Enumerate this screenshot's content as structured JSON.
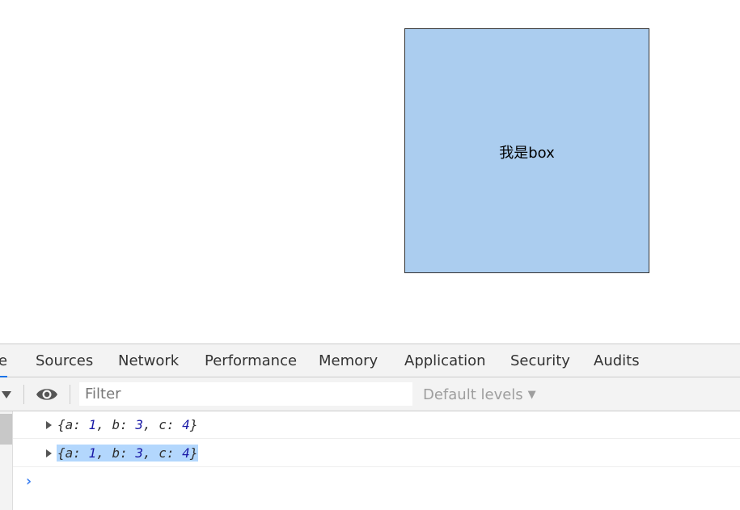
{
  "page": {
    "box_label": "我是box",
    "box_color": "#abcdef"
  },
  "devtools": {
    "tabs": [
      {
        "label": "e",
        "active": true
      },
      {
        "label": "Sources"
      },
      {
        "label": "Network"
      },
      {
        "label": "Performance"
      },
      {
        "label": "Memory"
      },
      {
        "label": "Application"
      },
      {
        "label": "Security"
      },
      {
        "label": "Audits"
      }
    ],
    "toolbar": {
      "context_dropdown_icon": "triangle-down-icon",
      "eye_icon": "eye-icon",
      "filter_placeholder": "Filter",
      "levels_label": "Default levels",
      "levels_caret": "▼"
    },
    "console": {
      "logs": [
        {
          "open": "{",
          "parts": [
            {
              "key": "a: ",
              "val": "1"
            },
            {
              "key": ", b: ",
              "val": "3"
            },
            {
              "key": ", c: ",
              "val": "4"
            }
          ],
          "close": "}",
          "selected": false
        },
        {
          "open": "{",
          "parts": [
            {
              "key": "a: ",
              "val": "1"
            },
            {
              "key": ", b: ",
              "val": "3"
            },
            {
              "key": ", c: ",
              "val": "4"
            }
          ],
          "close": "}",
          "selected": true
        }
      ],
      "prompt": "›"
    },
    "accent_color": "#1a73e8"
  }
}
